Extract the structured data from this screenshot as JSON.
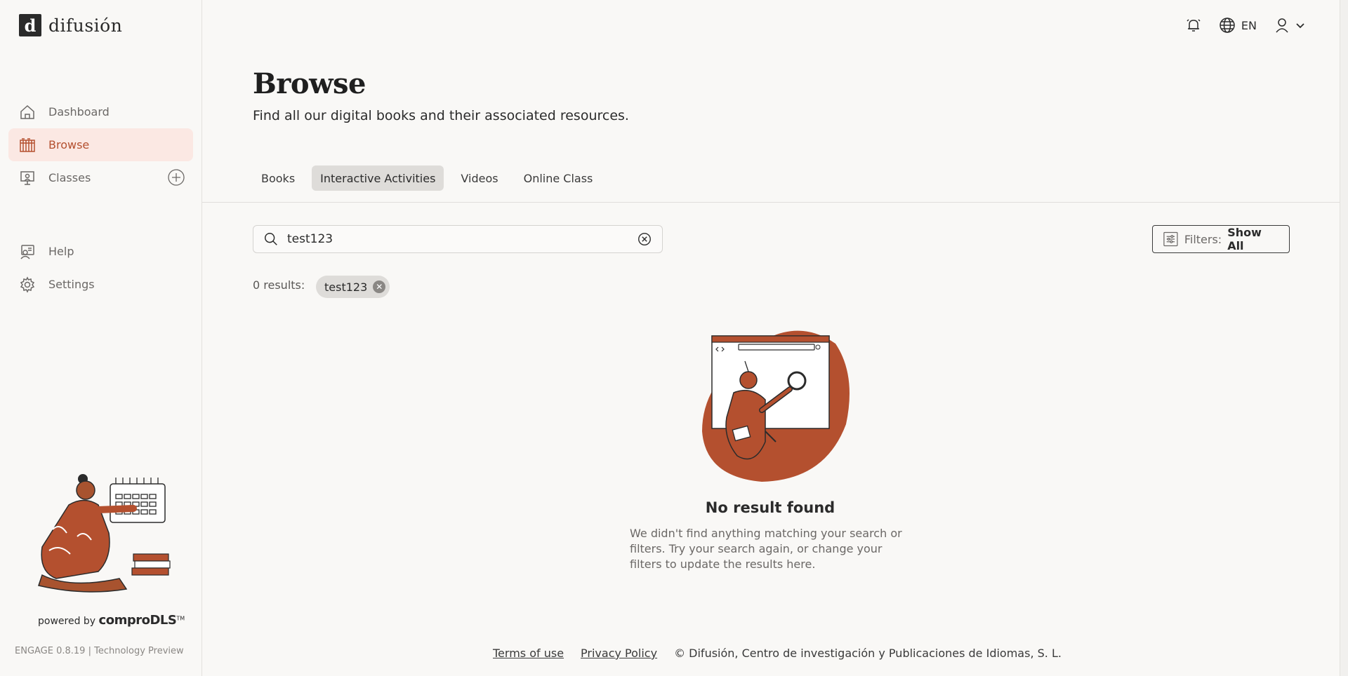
{
  "app": {
    "logo_mark": "d",
    "logo_text": "difusión"
  },
  "sidebar": {
    "items": [
      {
        "label": "Dashboard",
        "icon": "home-icon"
      },
      {
        "label": "Browse",
        "icon": "library-icon"
      },
      {
        "label": "Classes",
        "icon": "classroom-icon"
      },
      {
        "label": "Help",
        "icon": "help-icon"
      },
      {
        "label": "Settings",
        "icon": "gear-icon"
      }
    ],
    "powered_prefix": "powered by",
    "powered_brand": "comproDLS",
    "powered_tm": "TM",
    "version": "ENGAGE 0.8.19 | Technology Preview"
  },
  "topbar": {
    "language": "EN"
  },
  "main": {
    "title": "Browse",
    "subtitle": "Find all our digital books and their associated resources.",
    "tabs": [
      {
        "label": "Books"
      },
      {
        "label": "Interactive Activities",
        "active": true
      },
      {
        "label": "Videos"
      },
      {
        "label": "Online Class"
      }
    ],
    "search": {
      "value": "test123"
    },
    "filters": {
      "label": "Filters:",
      "value": "Show All"
    },
    "results_label": "0 results:",
    "chip_label": "test123",
    "empty": {
      "title": "No result found",
      "text": "We didn't find anything matching your search or filters. Try your search again, or change your filters to update the results here."
    }
  },
  "footer": {
    "terms": "Terms of use",
    "privacy": "Privacy Policy",
    "copyright": "© Difusión, Centro de investigación y Publicaciones de Idiomas, S. L."
  },
  "colors": {
    "accent": "#b4502f",
    "active_bg": "#fbe8e3",
    "background": "#f9f8f6"
  }
}
